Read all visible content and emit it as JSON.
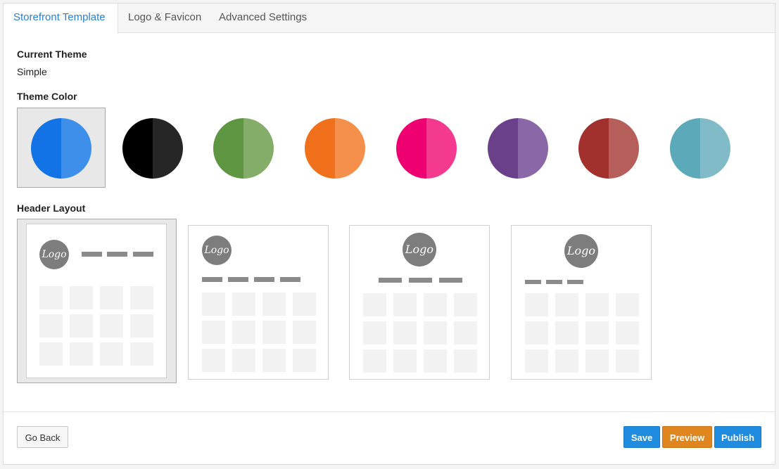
{
  "tabs": [
    {
      "label": "Storefront Template",
      "active": true
    },
    {
      "label": "Logo & Favicon",
      "active": false
    },
    {
      "label": "Advanced Settings",
      "active": false
    }
  ],
  "current_theme": {
    "label": "Current Theme",
    "value": "Simple"
  },
  "theme_color": {
    "label": "Theme Color",
    "selected_index": 0,
    "colors": [
      {
        "dark": "#1273e6",
        "light": "#3d8fea"
      },
      {
        "dark": "#000000",
        "light": "#262626"
      },
      {
        "dark": "#5f9641",
        "light": "#84ad69"
      },
      {
        "dark": "#f0701b",
        "light": "#f48f4c"
      },
      {
        "dark": "#ef0070",
        "light": "#f43a8f"
      },
      {
        "dark": "#6b408a",
        "light": "#8a67a6"
      },
      {
        "dark": "#a2302c",
        "light": "#b65e59"
      },
      {
        "dark": "#5caab9",
        "light": "#80bbc7"
      }
    ]
  },
  "header_layout": {
    "label": "Header Layout",
    "selected_index": 0,
    "logo_text": "Logo",
    "options": [
      "logo-left-nav-right",
      "logo-left-nav-below",
      "logo-center-nav-below",
      "logo-center-nav-left"
    ]
  },
  "footer": {
    "go_back": "Go Back",
    "save": "Save",
    "preview": "Preview",
    "publish": "Publish"
  }
}
